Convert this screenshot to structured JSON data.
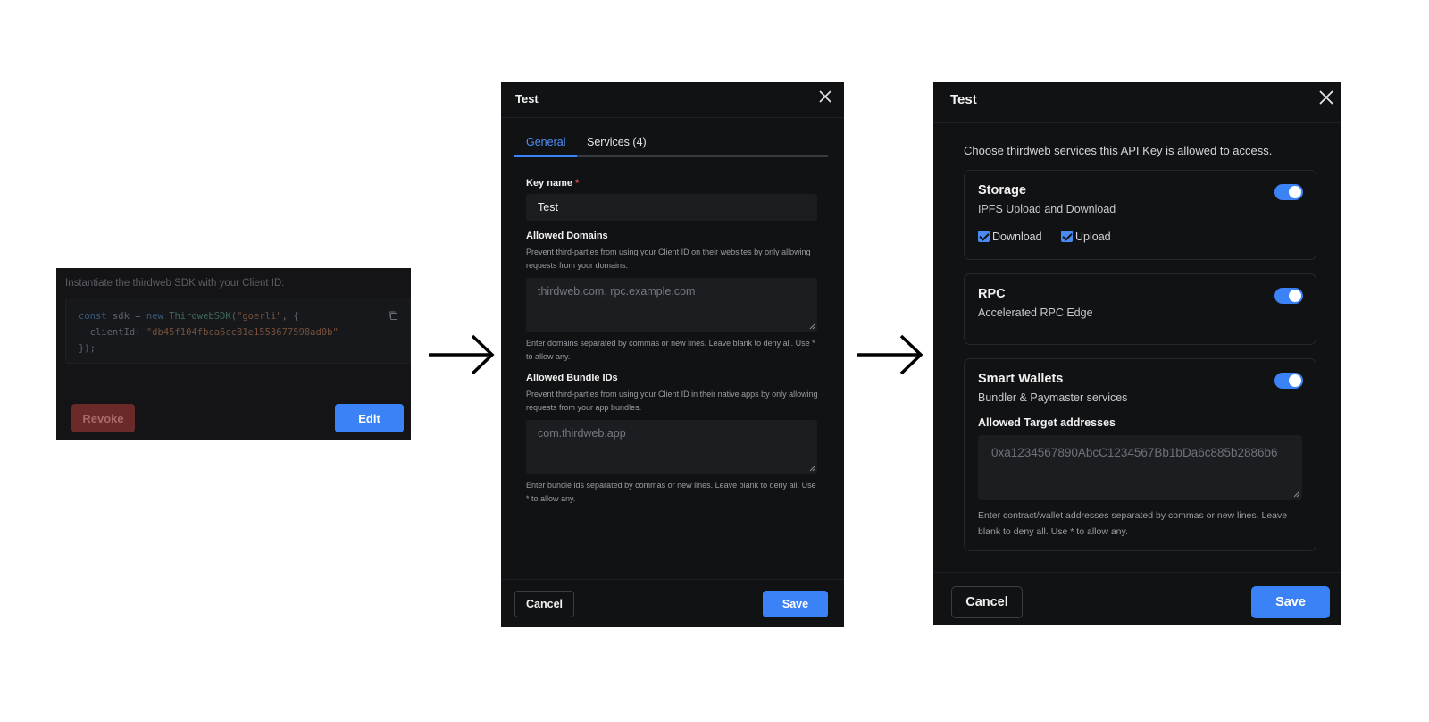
{
  "panel1": {
    "instruction": "Instantiate the thirdweb SDK with your Client ID:",
    "code": {
      "line1_kw1": "const",
      "line1_var": " sdk = ",
      "line1_kw2": "new",
      "line1_cls": " ThirdwebSDK",
      "line1_open": "(",
      "line1_str": "\"goerli\"",
      "line1_rest": ", {",
      "line2_key": "  clientId: ",
      "line2_str": "\"db45f104fbca6cc81e1553677598ad0b\"",
      "line3": "});"
    },
    "copy_icon": "copy-icon",
    "revoke_label": "Revoke",
    "edit_label": "Edit",
    "colors": {
      "revoke_bg": "#6b2a2a",
      "edit_bg": "#3b82f6"
    }
  },
  "panel2": {
    "title": "Test",
    "tabs": [
      {
        "label": "General",
        "active": true
      },
      {
        "label": "Services (4)",
        "active": false
      }
    ],
    "key_name": {
      "label": "Key name",
      "required_mark": "*",
      "value": "Test"
    },
    "allowed_domains": {
      "label": "Allowed Domains",
      "description": "Prevent third-parties from using your Client ID on their websites by only allowing requests from your domains.",
      "placeholder": "thirdweb.com, rpc.example.com",
      "hint": "Enter domains separated by commas or new lines. Leave blank to deny all. Use * to allow any."
    },
    "allowed_bundle_ids": {
      "label": "Allowed Bundle IDs",
      "description": "Prevent third-parties from using your Client ID in their native apps by only allowing requests from your app bundles.",
      "placeholder": "com.thirdweb.app",
      "hint": "Enter bundle ids separated by commas or new lines. Leave blank to deny all. Use * to allow any."
    },
    "cancel_label": "Cancel",
    "save_label": "Save"
  },
  "panel3": {
    "title": "Test",
    "intro": "Choose thirdweb services this API Key is allowed to access.",
    "services": [
      {
        "name": "Storage",
        "description": "IPFS Upload and Download",
        "enabled": true,
        "actions": [
          {
            "label": "Download",
            "checked": true
          },
          {
            "label": "Upload",
            "checked": true
          }
        ]
      },
      {
        "name": "RPC",
        "description": "Accelerated RPC Edge",
        "enabled": true
      },
      {
        "name": "Smart Wallets",
        "description": "Bundler & Paymaster services",
        "enabled": true,
        "target_label": "Allowed Target addresses",
        "target_placeholder": "0xa1234567890AbcC1234567Bb1bDa6c885b2886b6",
        "target_hint": "Enter contract/wallet addresses separated by commas or new lines. Leave blank to deny all. Use * to allow any."
      }
    ],
    "cancel_label": "Cancel",
    "save_label": "Save"
  },
  "colors": {
    "accent": "#3b82f6",
    "panel_bg": "#111214",
    "danger": "#e35b5b"
  }
}
